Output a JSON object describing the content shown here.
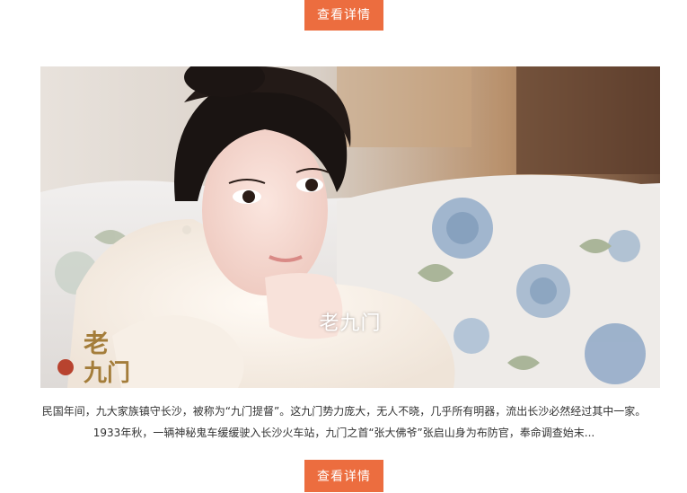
{
  "buttons": {
    "top_label": "查看详情",
    "bottom_label": "查看详情"
  },
  "hero": {
    "title": "老九门",
    "logo_text": "老九门"
  },
  "description": "民国年间，九大家族镇守长沙，被称为“九门提督”。这九门势力庞大，无人不晓，几乎所有明器，流出长沙必然经过其中一家。1933年秋，一辆神秘鬼车缓缓驶入长沙火车站，九门之首“张大佛爷”张启山身为布防官，奉命调查始末...",
  "colors": {
    "button": "#ec6d3f",
    "button_text": "#ffffff",
    "text": "#333333"
  }
}
